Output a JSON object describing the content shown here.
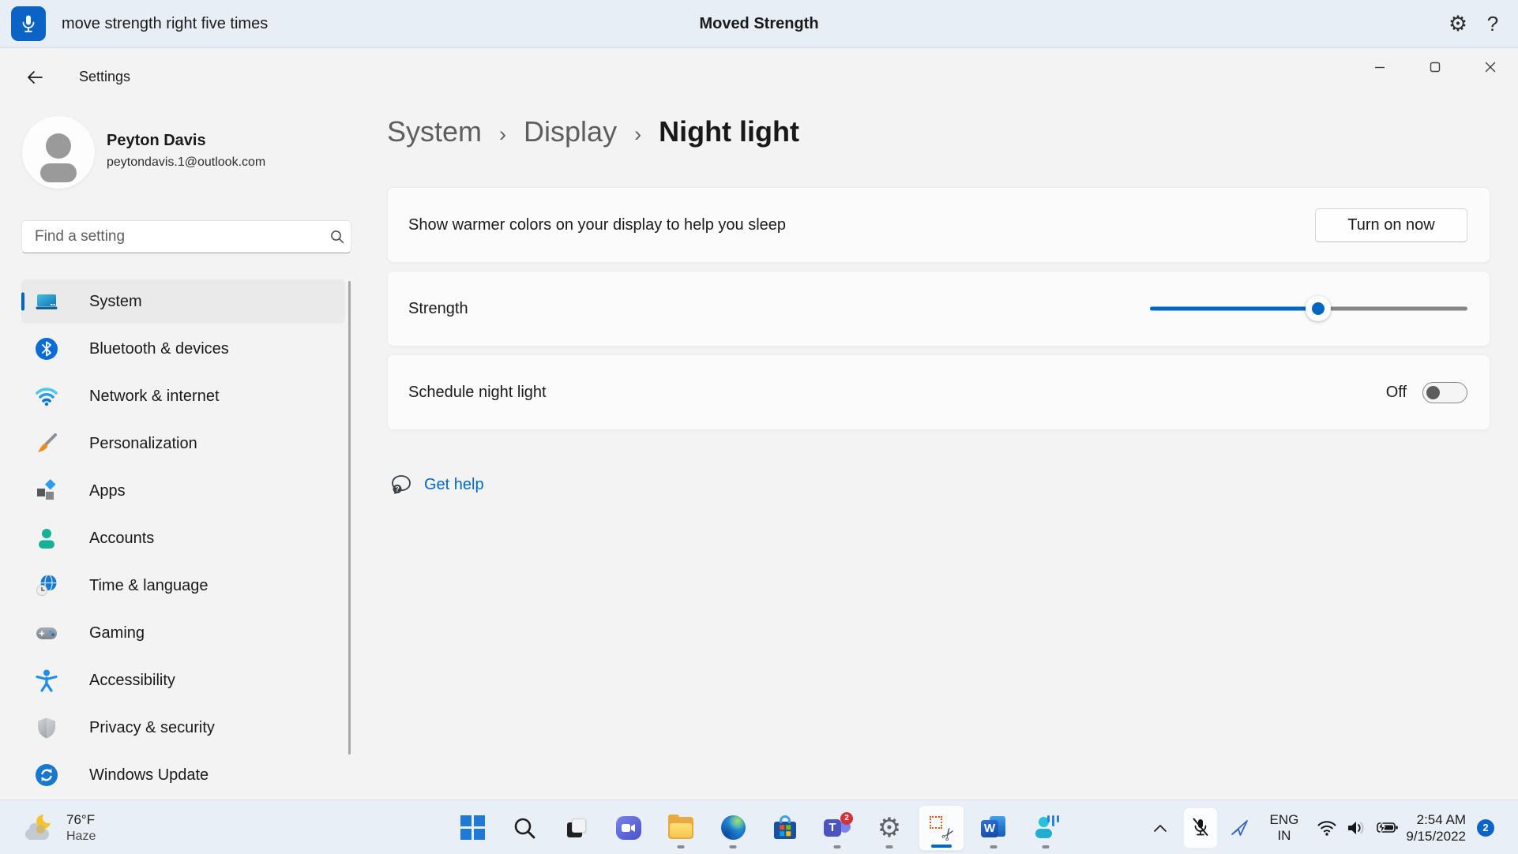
{
  "voice_bar": {
    "command": "move strength right five times",
    "status_title": "Moved Strength",
    "gear_glyph": "⚙",
    "help_glyph": "?"
  },
  "window": {
    "title": "Settings"
  },
  "account": {
    "name": "Peyton Davis",
    "email": "peytondavis.1@outlook.com"
  },
  "search": {
    "placeholder": "Find a setting"
  },
  "sidebar": {
    "items": [
      {
        "label": "System",
        "icon": "system-icon",
        "selected": true
      },
      {
        "label": "Bluetooth & devices",
        "icon": "bluetooth-icon"
      },
      {
        "label": "Network & internet",
        "icon": "network-icon"
      },
      {
        "label": "Personalization",
        "icon": "personalization-icon"
      },
      {
        "label": "Apps",
        "icon": "apps-icon"
      },
      {
        "label": "Accounts",
        "icon": "accounts-icon"
      },
      {
        "label": "Time & language",
        "icon": "time-language-icon"
      },
      {
        "label": "Gaming",
        "icon": "gaming-icon"
      },
      {
        "label": "Accessibility",
        "icon": "accessibility-icon"
      },
      {
        "label": "Privacy & security",
        "icon": "privacy-icon"
      },
      {
        "label": "Windows Update",
        "icon": "windows-update-icon"
      }
    ]
  },
  "breadcrumb": {
    "separator": "›",
    "parts": [
      "System",
      "Display",
      "Night light"
    ]
  },
  "night_light": {
    "warmer": {
      "text": "Show warmer colors on your display to help you sleep",
      "button": "Turn on now"
    },
    "strength": {
      "label": "Strength",
      "value_percent": 53
    },
    "schedule": {
      "label": "Schedule night light",
      "toggle_state": "Off"
    }
  },
  "help_link": {
    "label": "Get help"
  },
  "taskbar": {
    "weather": {
      "temperature": "76°F",
      "condition": "Haze"
    },
    "apps": [
      {
        "name": "start"
      },
      {
        "name": "search"
      },
      {
        "name": "task-view"
      },
      {
        "name": "chat"
      },
      {
        "name": "file-explorer",
        "running": true
      },
      {
        "name": "edge",
        "running": true
      },
      {
        "name": "store"
      },
      {
        "name": "teams",
        "running": true,
        "badge": "2",
        "label": "T"
      },
      {
        "name": "settings",
        "running": true
      },
      {
        "name": "snipping-tool",
        "active": true
      },
      {
        "name": "word",
        "running": true,
        "label": "W"
      },
      {
        "name": "voice-access",
        "running": true
      }
    ],
    "tray": {
      "language_top": "ENG",
      "language_bottom": "IN",
      "time": "2:54 AM",
      "date": "9/15/2022",
      "notification_count": "2"
    }
  },
  "colors": {
    "accent": "#0067c0",
    "link": "#0068c7",
    "badge_red": "#d13438"
  }
}
